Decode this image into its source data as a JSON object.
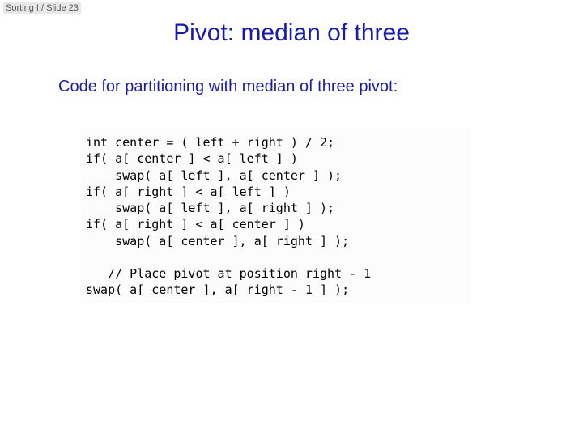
{
  "header": {
    "label": "Sorting II/ Slide 23"
  },
  "title": "Pivot: median of three",
  "subtitle": "Code for partitioning with median of three pivot:",
  "code": "int center = ( left + right ) / 2;\nif( a[ center ] < a[ left ] )\n    swap( a[ left ], a[ center ] );\nif( a[ right ] < a[ left ] )\n    swap( a[ left ], a[ right ] );\nif( a[ right ] < a[ center ] )\n    swap( a[ center ], a[ right ] );\n\n   // Place pivot at position right - 1\nswap( a[ center ], a[ right - 1 ] );"
}
